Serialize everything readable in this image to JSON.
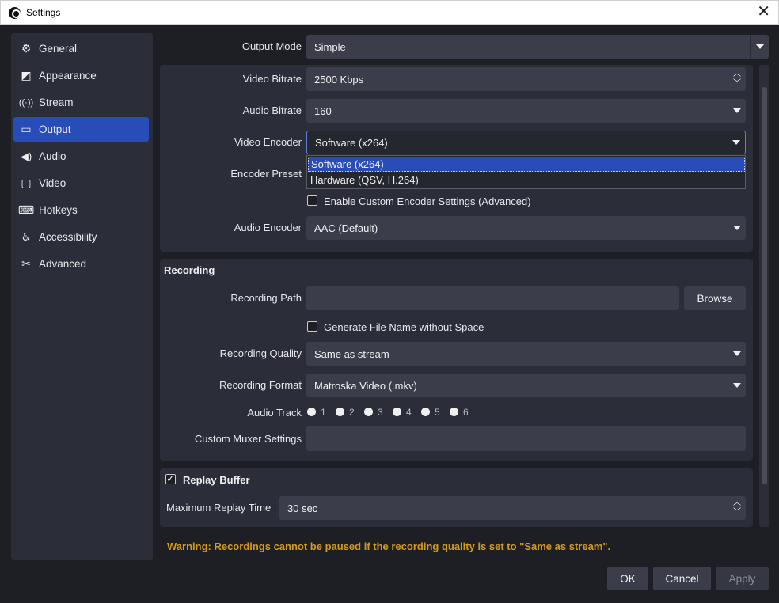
{
  "window": {
    "title": "Settings",
    "close_glyph": "✕"
  },
  "sidebar": {
    "items": [
      {
        "label": "General",
        "icon": "gear-icon",
        "glyph": "⚙"
      },
      {
        "label": "Appearance",
        "icon": "appearance-icon",
        "glyph": "◩"
      },
      {
        "label": "Stream",
        "icon": "broadcast-icon",
        "glyph": "📡"
      },
      {
        "label": "Output",
        "icon": "output-icon",
        "glyph": "▭"
      },
      {
        "label": "Audio",
        "icon": "speaker-icon",
        "glyph": "🔊"
      },
      {
        "label": "Video",
        "icon": "monitor-icon",
        "glyph": "▢"
      },
      {
        "label": "Hotkeys",
        "icon": "keyboard-icon",
        "glyph": "⌨"
      },
      {
        "label": "Accessibility",
        "icon": "accessibility-icon",
        "glyph": "♿"
      },
      {
        "label": "Advanced",
        "icon": "tools-icon",
        "glyph": "✂"
      }
    ],
    "active": "Output"
  },
  "output_mode": {
    "label": "Output Mode",
    "value": "Simple"
  },
  "streaming": {
    "video_bitrate": {
      "label": "Video Bitrate",
      "value": "2500 Kbps"
    },
    "audio_bitrate": {
      "label": "Audio Bitrate",
      "value": "160"
    },
    "video_encoder": {
      "label": "Video Encoder",
      "value": "Software (x264)",
      "options": [
        "Software (x264)",
        "Hardware (QSV, H.264)"
      ]
    },
    "encoder_preset": {
      "label": "Encoder Preset"
    },
    "custom_encoder": {
      "label": "Enable Custom Encoder Settings (Advanced)",
      "checked": false
    },
    "audio_encoder": {
      "label": "Audio Encoder",
      "value": "AAC (Default)"
    }
  },
  "recording": {
    "title": "Recording",
    "path": {
      "label": "Recording Path",
      "value": "",
      "browse": "Browse"
    },
    "file_name_no_space": {
      "label": "Generate File Name without Space",
      "checked": false
    },
    "quality": {
      "label": "Recording Quality",
      "value": "Same as stream"
    },
    "format": {
      "label": "Recording Format",
      "value": "Matroska Video (.mkv)"
    },
    "audio_track": {
      "label": "Audio Track",
      "tracks": [
        "1",
        "2",
        "3",
        "4",
        "5",
        "6"
      ]
    },
    "muxer": {
      "label": "Custom Muxer Settings",
      "value": ""
    }
  },
  "replay_buffer": {
    "title": "Replay Buffer",
    "checked": true,
    "max_time": {
      "label": "Maximum Replay Time",
      "value": "30 sec"
    }
  },
  "warning": "Warning: Recordings cannot be paused if the recording quality is set to \"Same as stream\".",
  "buttons": {
    "ok": "OK",
    "cancel": "Cancel",
    "apply": "Apply"
  },
  "colors": {
    "accent": "#284cb8",
    "warning": "#d49a1c",
    "background": "#1e1f25",
    "panel": "#2b2e38"
  }
}
